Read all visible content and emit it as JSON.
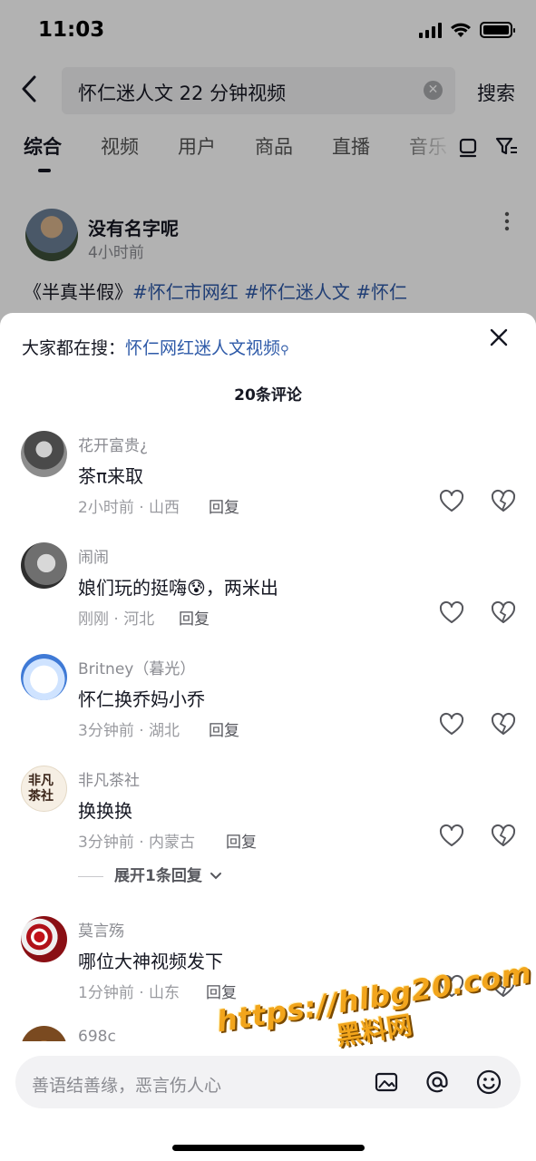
{
  "status_bar": {
    "time": "11:03"
  },
  "search": {
    "query": "怀仁迷人文 22 分钟视频",
    "submit_label": "搜索"
  },
  "tabs": [
    {
      "label": "综合",
      "active": true
    },
    {
      "label": "视频"
    },
    {
      "label": "用户"
    },
    {
      "label": "商品"
    },
    {
      "label": "直播"
    },
    {
      "label": "音乐"
    }
  ],
  "post": {
    "author": "没有名字呢",
    "time": "4小时前",
    "text_prefix": "《半真半假》",
    "tags": "#怀仁市网红 #怀仁迷人文 #怀仁"
  },
  "comments_sheet": {
    "hot_search_label": "大家都在搜：",
    "hot_search_keyword": "怀仁网红迷人文视频",
    "count_label": "20条评论",
    "comments": [
      {
        "name": "花开富贵¿",
        "text": "茶π来取",
        "meta": "2小时前 · 山西",
        "reply": "回复",
        "avatar": "man-in-hood"
      },
      {
        "name": "闹闹",
        "text": "娘们玩的挺嗨😰，两米出",
        "meta": "刚刚 · 河北",
        "reply": "回复",
        "avatar": "gray-figure"
      },
      {
        "name": "Britney（暮光）",
        "text": "怀仁换乔妈小乔",
        "meta": "3分钟前 · 湖北",
        "reply": "回复",
        "avatar": "white-puppy"
      },
      {
        "name": "非凡茶社",
        "text": "换换换",
        "meta": "3分钟前 · 内蒙古",
        "reply": "回复",
        "avatar": "tea-shop-logo",
        "avatar_text": "非凡茶社"
      },
      {
        "name": "莫言殇",
        "text": "哪位大神视频发下",
        "meta": "1分钟前 · 山东",
        "reply": "回复",
        "avatar": "roses"
      }
    ],
    "expand_label": "展开1条回复",
    "partial_name": "698c"
  },
  "input": {
    "placeholder": "善语结善缘，恶言伤人心"
  },
  "watermark": {
    "url": "https://hlbg20.com",
    "name": "黑料网"
  },
  "colors": {
    "link": "#2e5aa8",
    "watermark": "#f2a51c"
  }
}
